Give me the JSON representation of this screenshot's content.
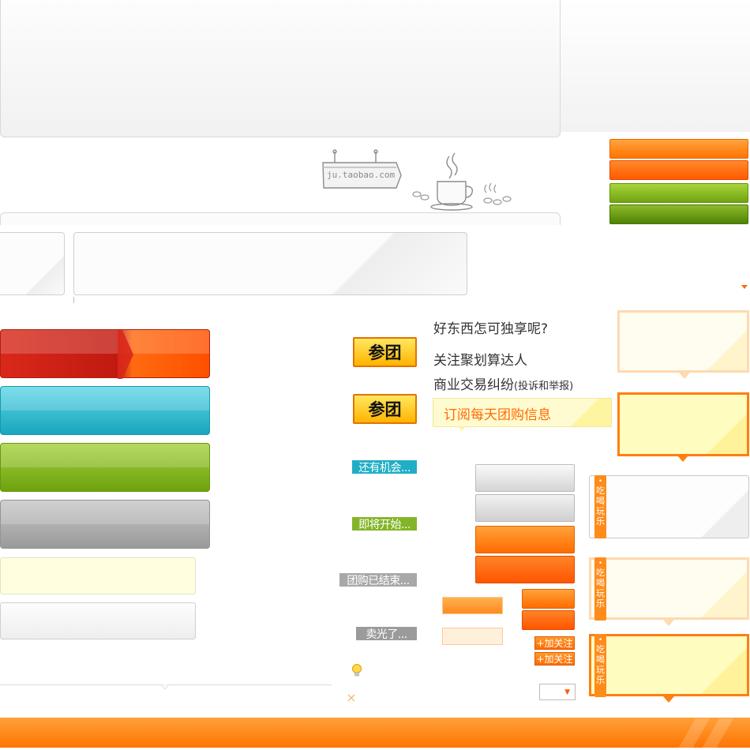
{
  "colors": {
    "orange": "#ff7300",
    "orange_dark": "#ff5500",
    "green": "#84b528",
    "cyan": "#20aec6",
    "grey": "#a8a8a8",
    "red": "#c01a10",
    "yellow_light": "#ffffe0"
  },
  "sketch": {
    "sign_text": "ju.taobao.com",
    "icons": [
      "signboard-icon",
      "coffee-cup-icon",
      "coffee-beans-icon"
    ]
  },
  "join_buttons": {
    "label_1": "参团",
    "label_2": "参团"
  },
  "status_tags": {
    "more_chances": "还有机会...",
    "starting_soon": "即将开始...",
    "group_ended": "团购已结束...",
    "sold_out": "卖光了..."
  },
  "promo": {
    "line_1": "好东西怎可独享呢?",
    "line_2": "关注聚划算达人",
    "line_3_main": "商业交易纠纷",
    "line_3_note": "(投诉和举报)",
    "subscribe": "订阅每天团购信息"
  },
  "follow_buttons": {
    "label_1": "+加关注",
    "label_2": "+加关注"
  },
  "side_tabs": {
    "dot": "•",
    "text": [
      "吃",
      "喝",
      "玩",
      "乐"
    ]
  },
  "icons": {
    "bulb": "bulb-icon",
    "close": "close-icon",
    "dropdown": "dropdown-arrow-icon"
  }
}
